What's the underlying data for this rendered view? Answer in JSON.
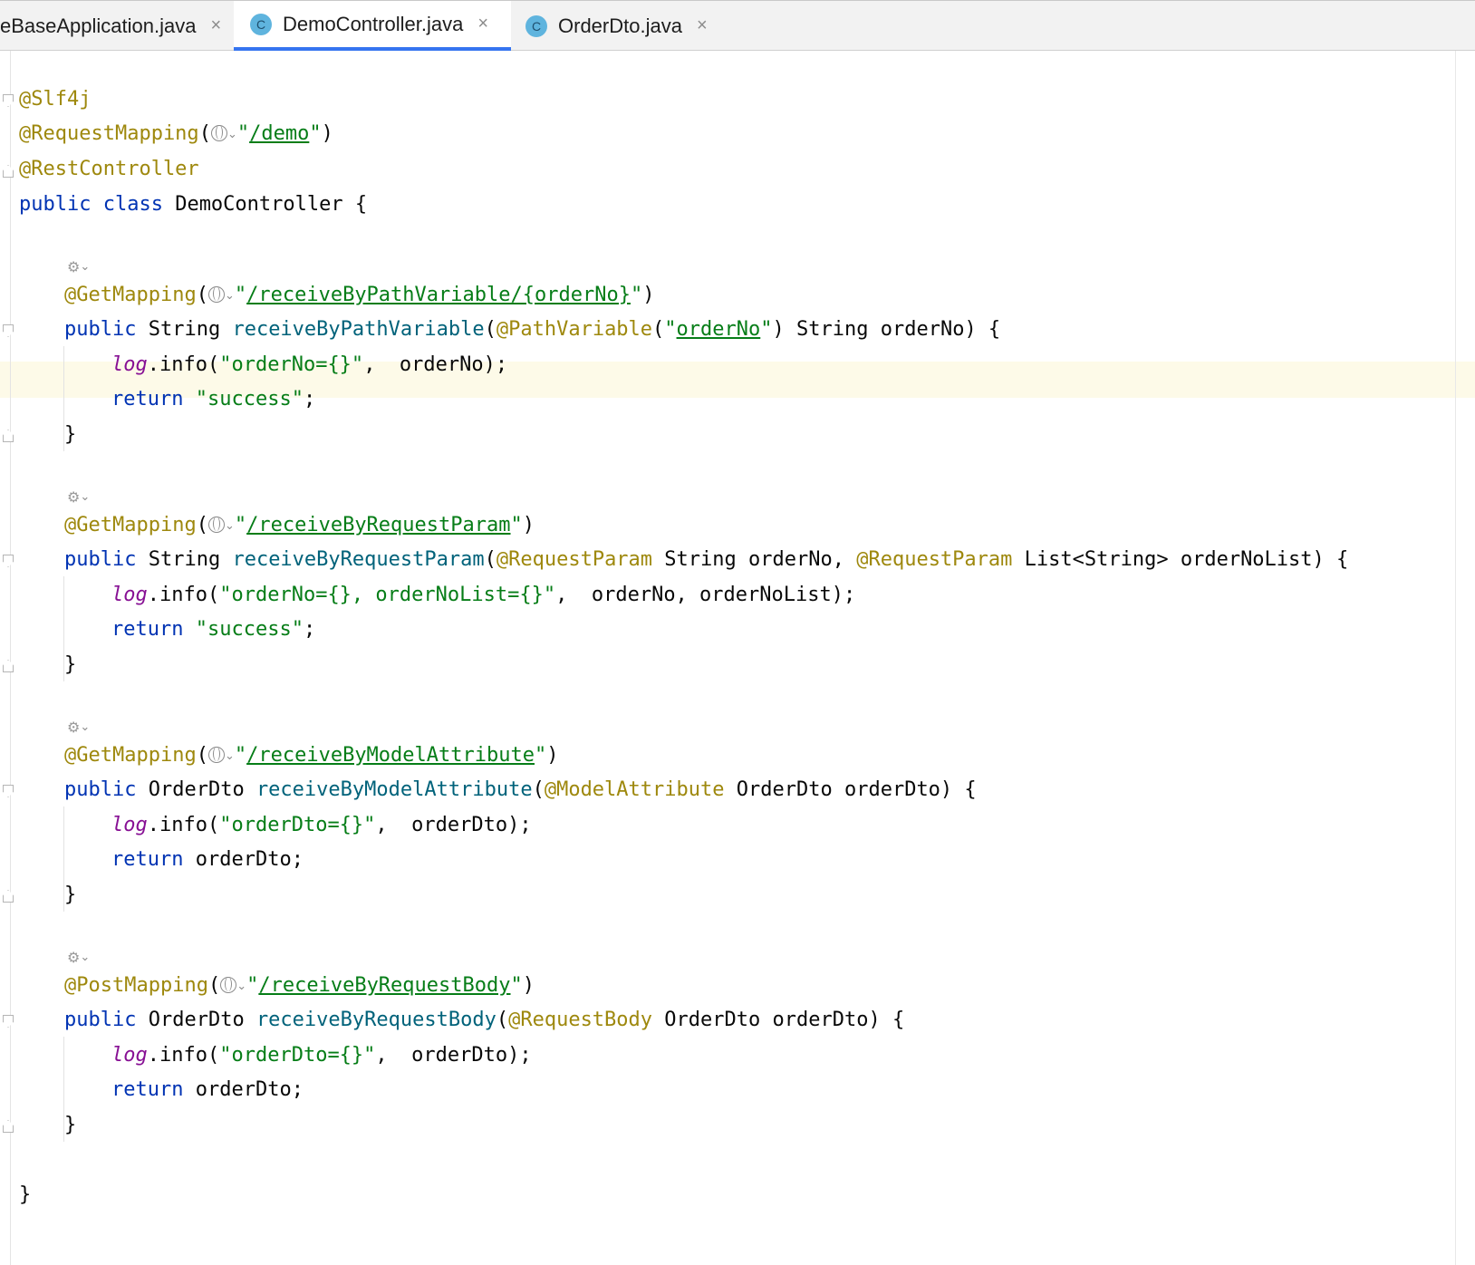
{
  "tabs": [
    {
      "label": "eBaseApplication.java",
      "close": "×"
    },
    {
      "label": "DemoController.java",
      "icon": "C",
      "close": "×",
      "active": true
    },
    {
      "label": "OrderDto.java",
      "icon": "C",
      "close": "×"
    }
  ],
  "code": {
    "l1": "@Slf4j",
    "l2_ann": "@RequestMapping",
    "l2_url": "/demo",
    "l3": "@RestController",
    "l4_kw": "public class",
    "l4_rest": " DemoController {",
    "m1_ann": "@GetMapping",
    "m1_url": "/receiveByPathVariable/{orderNo}",
    "m1_sig_kw": "public",
    "m1_sig_type": " String ",
    "m1_sig_fn": "receiveByPathVariable",
    "m1_sig_ann": "@PathVariable",
    "m1_sig_url": "orderNo",
    "m1_sig_rest": ") String orderNo) {",
    "m1_log_str": "\"orderNo={}\"",
    "m1_log_rest": ",  orderNo);",
    "m1_ret_val": "\"success\"",
    "m2_ann": "@GetMapping",
    "m2_url": "/receiveByRequestParam",
    "m2_sig_fn": "receiveByRequestParam",
    "m2_sig_ann1": "@RequestParam",
    "m2_sig_mid": " String orderNo, ",
    "m2_sig_ann2": "@RequestParam",
    "m2_sig_rest": " List<String> orderNoList) {",
    "m2_log_str": "\"orderNo={}, orderNoList={}\"",
    "m2_log_rest": ",  orderNo, orderNoList);",
    "m2_ret_val": "\"success\"",
    "m3_ann": "@GetMapping",
    "m3_url": "/receiveByModelAttribute",
    "m3_sig_type": " OrderDto ",
    "m3_sig_fn": "receiveByModelAttribute",
    "m3_sig_ann": "@ModelAttribute",
    "m3_sig_rest": " OrderDto orderDto) {",
    "m3_log_str": "\"orderDto={}\"",
    "m3_log_rest": ",  orderDto);",
    "m3_ret_val": " orderDto;",
    "m4_ann": "@PostMapping",
    "m4_url": "/receiveByRequestBody",
    "m4_sig_fn": "receiveByRequestBody",
    "m4_sig_ann": "@RequestBody",
    "m4_sig_rest": " OrderDto orderDto) {",
    "m4_log_str": "\"orderDto={}\"",
    "m4_log_rest": ",  orderDto);",
    "m4_ret_val": " orderDto;",
    "log": "log",
    "info": ".info(",
    "ret": "return",
    "semi": ";",
    "close_brace": "}",
    "open_paren": "(",
    "quote": "\"",
    "close_paren": "\")",
    "public": "public",
    "string_type": " String "
  },
  "icons": {
    "hint": "bean-mapping-icon",
    "globe": "globe-icon",
    "chevron": "⌄",
    "tab_close": "close-icon",
    "tab_class": "class-icon"
  },
  "colors": {
    "annotation": "#9e880d",
    "keyword": "#0033b3",
    "string": "#067d17",
    "function": "#00627a",
    "field": "#871094",
    "tab_accent": "#3574f0",
    "caret_row": "#fdfae8"
  }
}
